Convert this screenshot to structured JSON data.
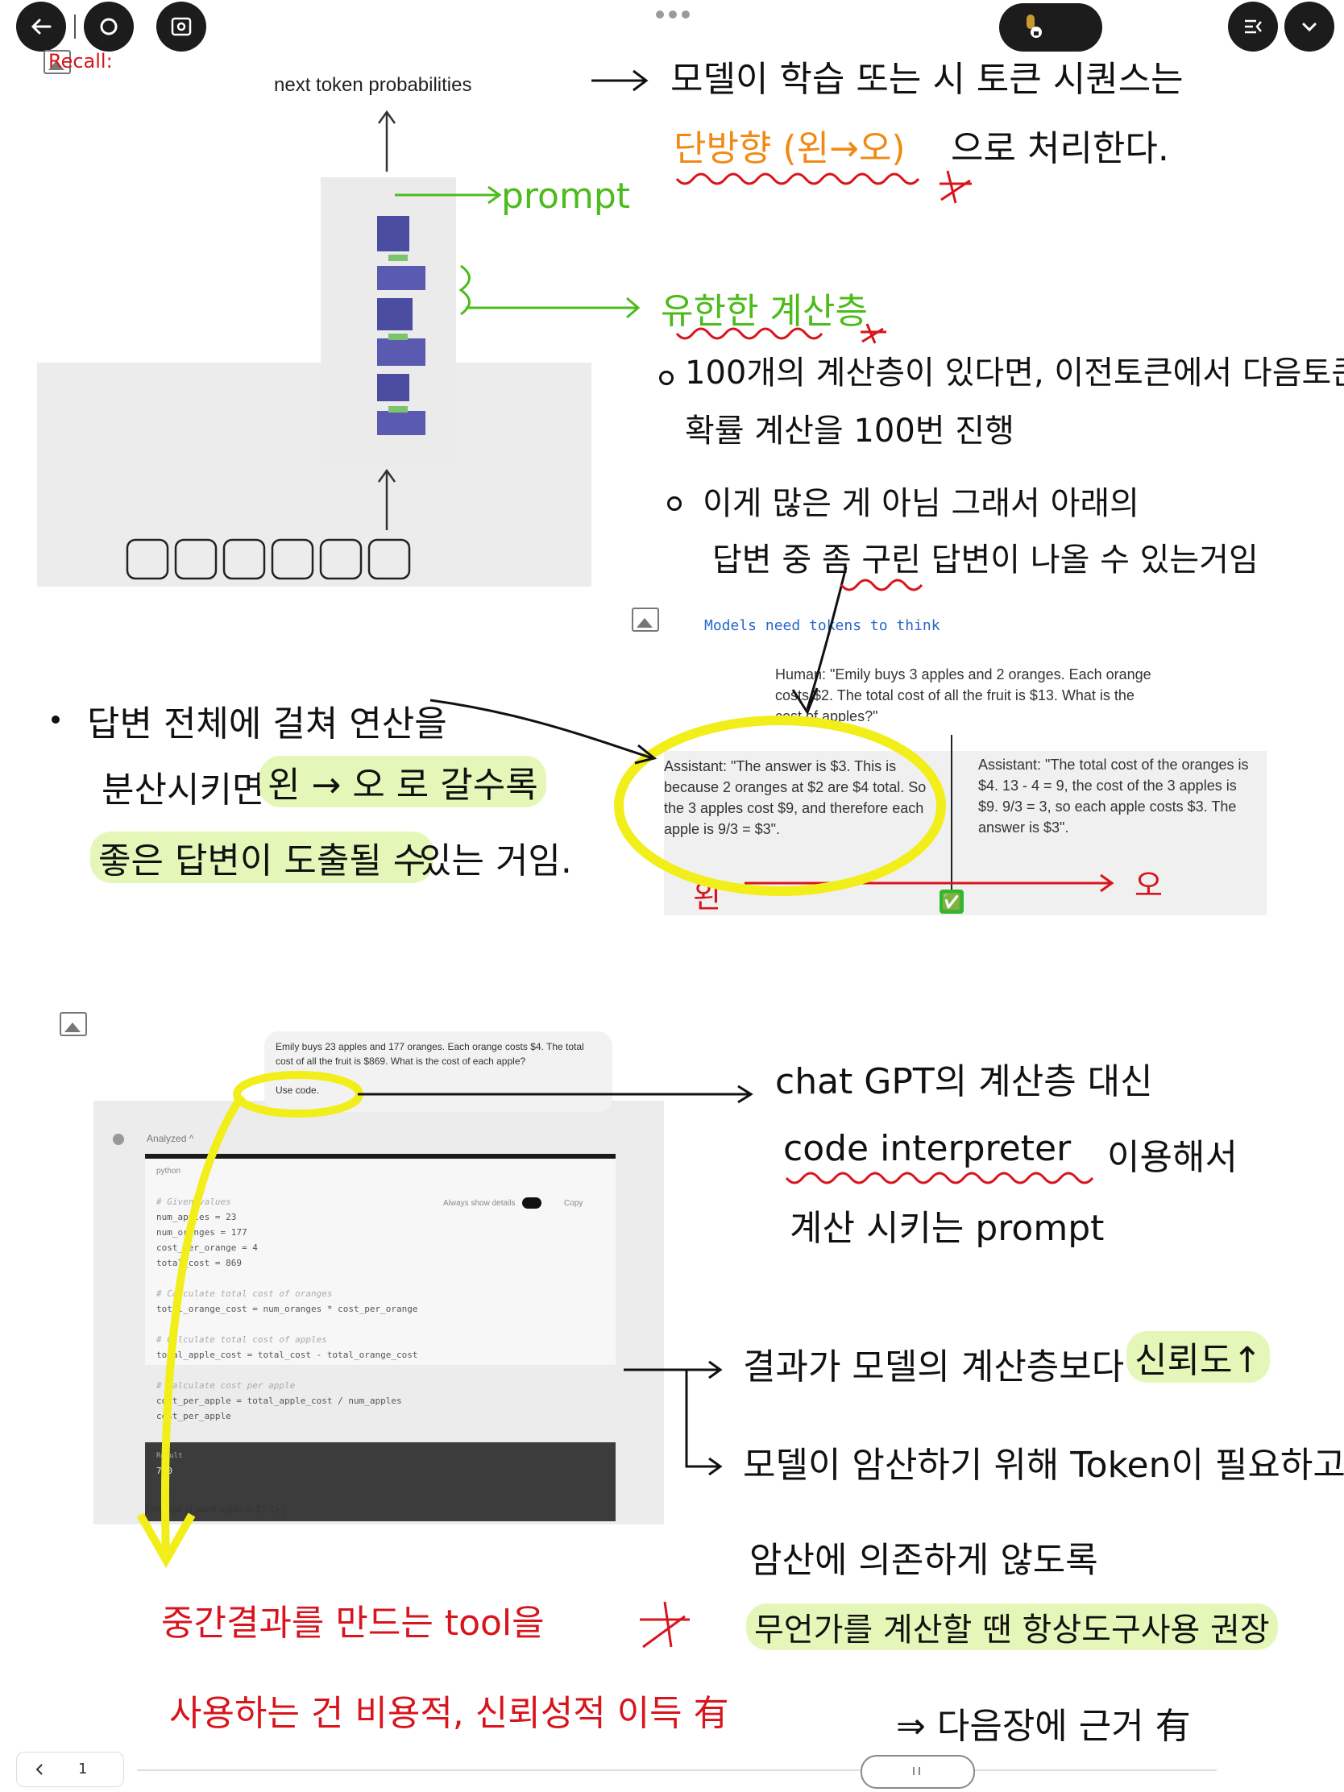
{
  "toolbar": {
    "back_icon": "arrow-left-icon",
    "home_icon": "circle-icon",
    "view_icon": "eye-frame-icon",
    "more_icon": "ellipsis-icon",
    "mic_icon": "microphone-lock-icon",
    "panel_icon": "panel-icon",
    "chevron_icon": "chevron-down-icon"
  },
  "recall_label": "Recall:",
  "fig1": {
    "title": "next token probabilities"
  },
  "notes1": {
    "prompt": "prompt",
    "line1": "모델이 학습 또는 시 토큰 시퀀스는",
    "line2_orange": "단방향 (왼→오)",
    "line2_rest": "으로 처리한다.",
    "finite_layers": "유한한 계산층",
    "bullet1_a": "100개의 계산층이 있다면, 이전토큰에서 다음토큰의",
    "bullet1_b": "확률 계산을 100번 진행",
    "bullet2_a": "이게 많은 게 아님 그래서 아래의",
    "bullet2_b": "답변 중 좀 구린 답변이 나올 수 있는거임"
  },
  "fig2": {
    "title": "Models need tokens to think",
    "human": "Human: \"Emily buys 3 apples and 2 oranges. Each orange costs $2. The total cost of all the fruit is $13. What is the cost of apples?\"",
    "left": "Assistant: \"The answer is $3. This is because 2 oranges at $2 are $4 total. So the 3 apples cost $9, and therefore each apple is 9/3 = $3\".",
    "right": "Assistant: \"The total cost of the oranges is $4. 13 - 4 = 9, the cost of the 3 apples is $9. 9/3 = 3, so each apple costs $3. The answer is $3\".",
    "check": "✅",
    "left_word": "왼",
    "right_word": "오"
  },
  "notes2": {
    "line1": "답변 전체에 걸쳐 연산을",
    "line2_a": "분산시키면",
    "line2_hl": "왼 → 오 로 갈수록",
    "line3_hl": "좋은 답변이 도출될 수",
    "line3_b": "있는 거임."
  },
  "fig3": {
    "user_msg": "Emily buys 23 apples and 177 oranges. Each orange costs $4. The total cost of all the fruit is $869. What is the cost of each apple?",
    "use_code": "Use code.",
    "analyzed": "Analyzed ^",
    "lang": "python",
    "always_show": "Always show details",
    "copy": "Copy",
    "code": [
      "# Given values",
      "num_apples = 23",
      "num_oranges = 177",
      "cost_per_orange = 4",
      "total_cost = 869",
      "",
      "# Calculate total cost of oranges",
      "total_orange_cost = num_oranges * cost_per_orange",
      "",
      "# Calculate total cost of apples",
      "total_apple_cost = total_cost - total_orange_cost",
      "",
      "# Calculate cost per apple",
      "cost_per_apple = total_apple_cost / num_apples",
      "cost_per_apple"
    ],
    "result_label": "Result",
    "result_value": "7.0",
    "answer": "The cost of each apple is $7. [>-]"
  },
  "notes3": {
    "chat1": "chat GPT의 계산층 대신",
    "chat2": "code interpreter",
    "chat2_rest": "이용해서",
    "chat3": "계산 시키는 prompt",
    "r1": "결과가 모델의 계산층보다",
    "r1_hl": "신뢰도↑",
    "r2": "모델이 암산하기 위해 Token이 필요하고,",
    "r3": "암산에 의존하게 않도록",
    "r4_hl": "무언가를 계산할 땐 항상도구사용 권장",
    "r5": "⇒ 다음장에 근거 有",
    "red1": "중간결과를 만드는 tool을",
    "red2": "사용하는 건 비용적, 신뢰성적 이득 有"
  },
  "footer": {
    "page": "1",
    "prev_icon": "chevron-left-icon"
  }
}
